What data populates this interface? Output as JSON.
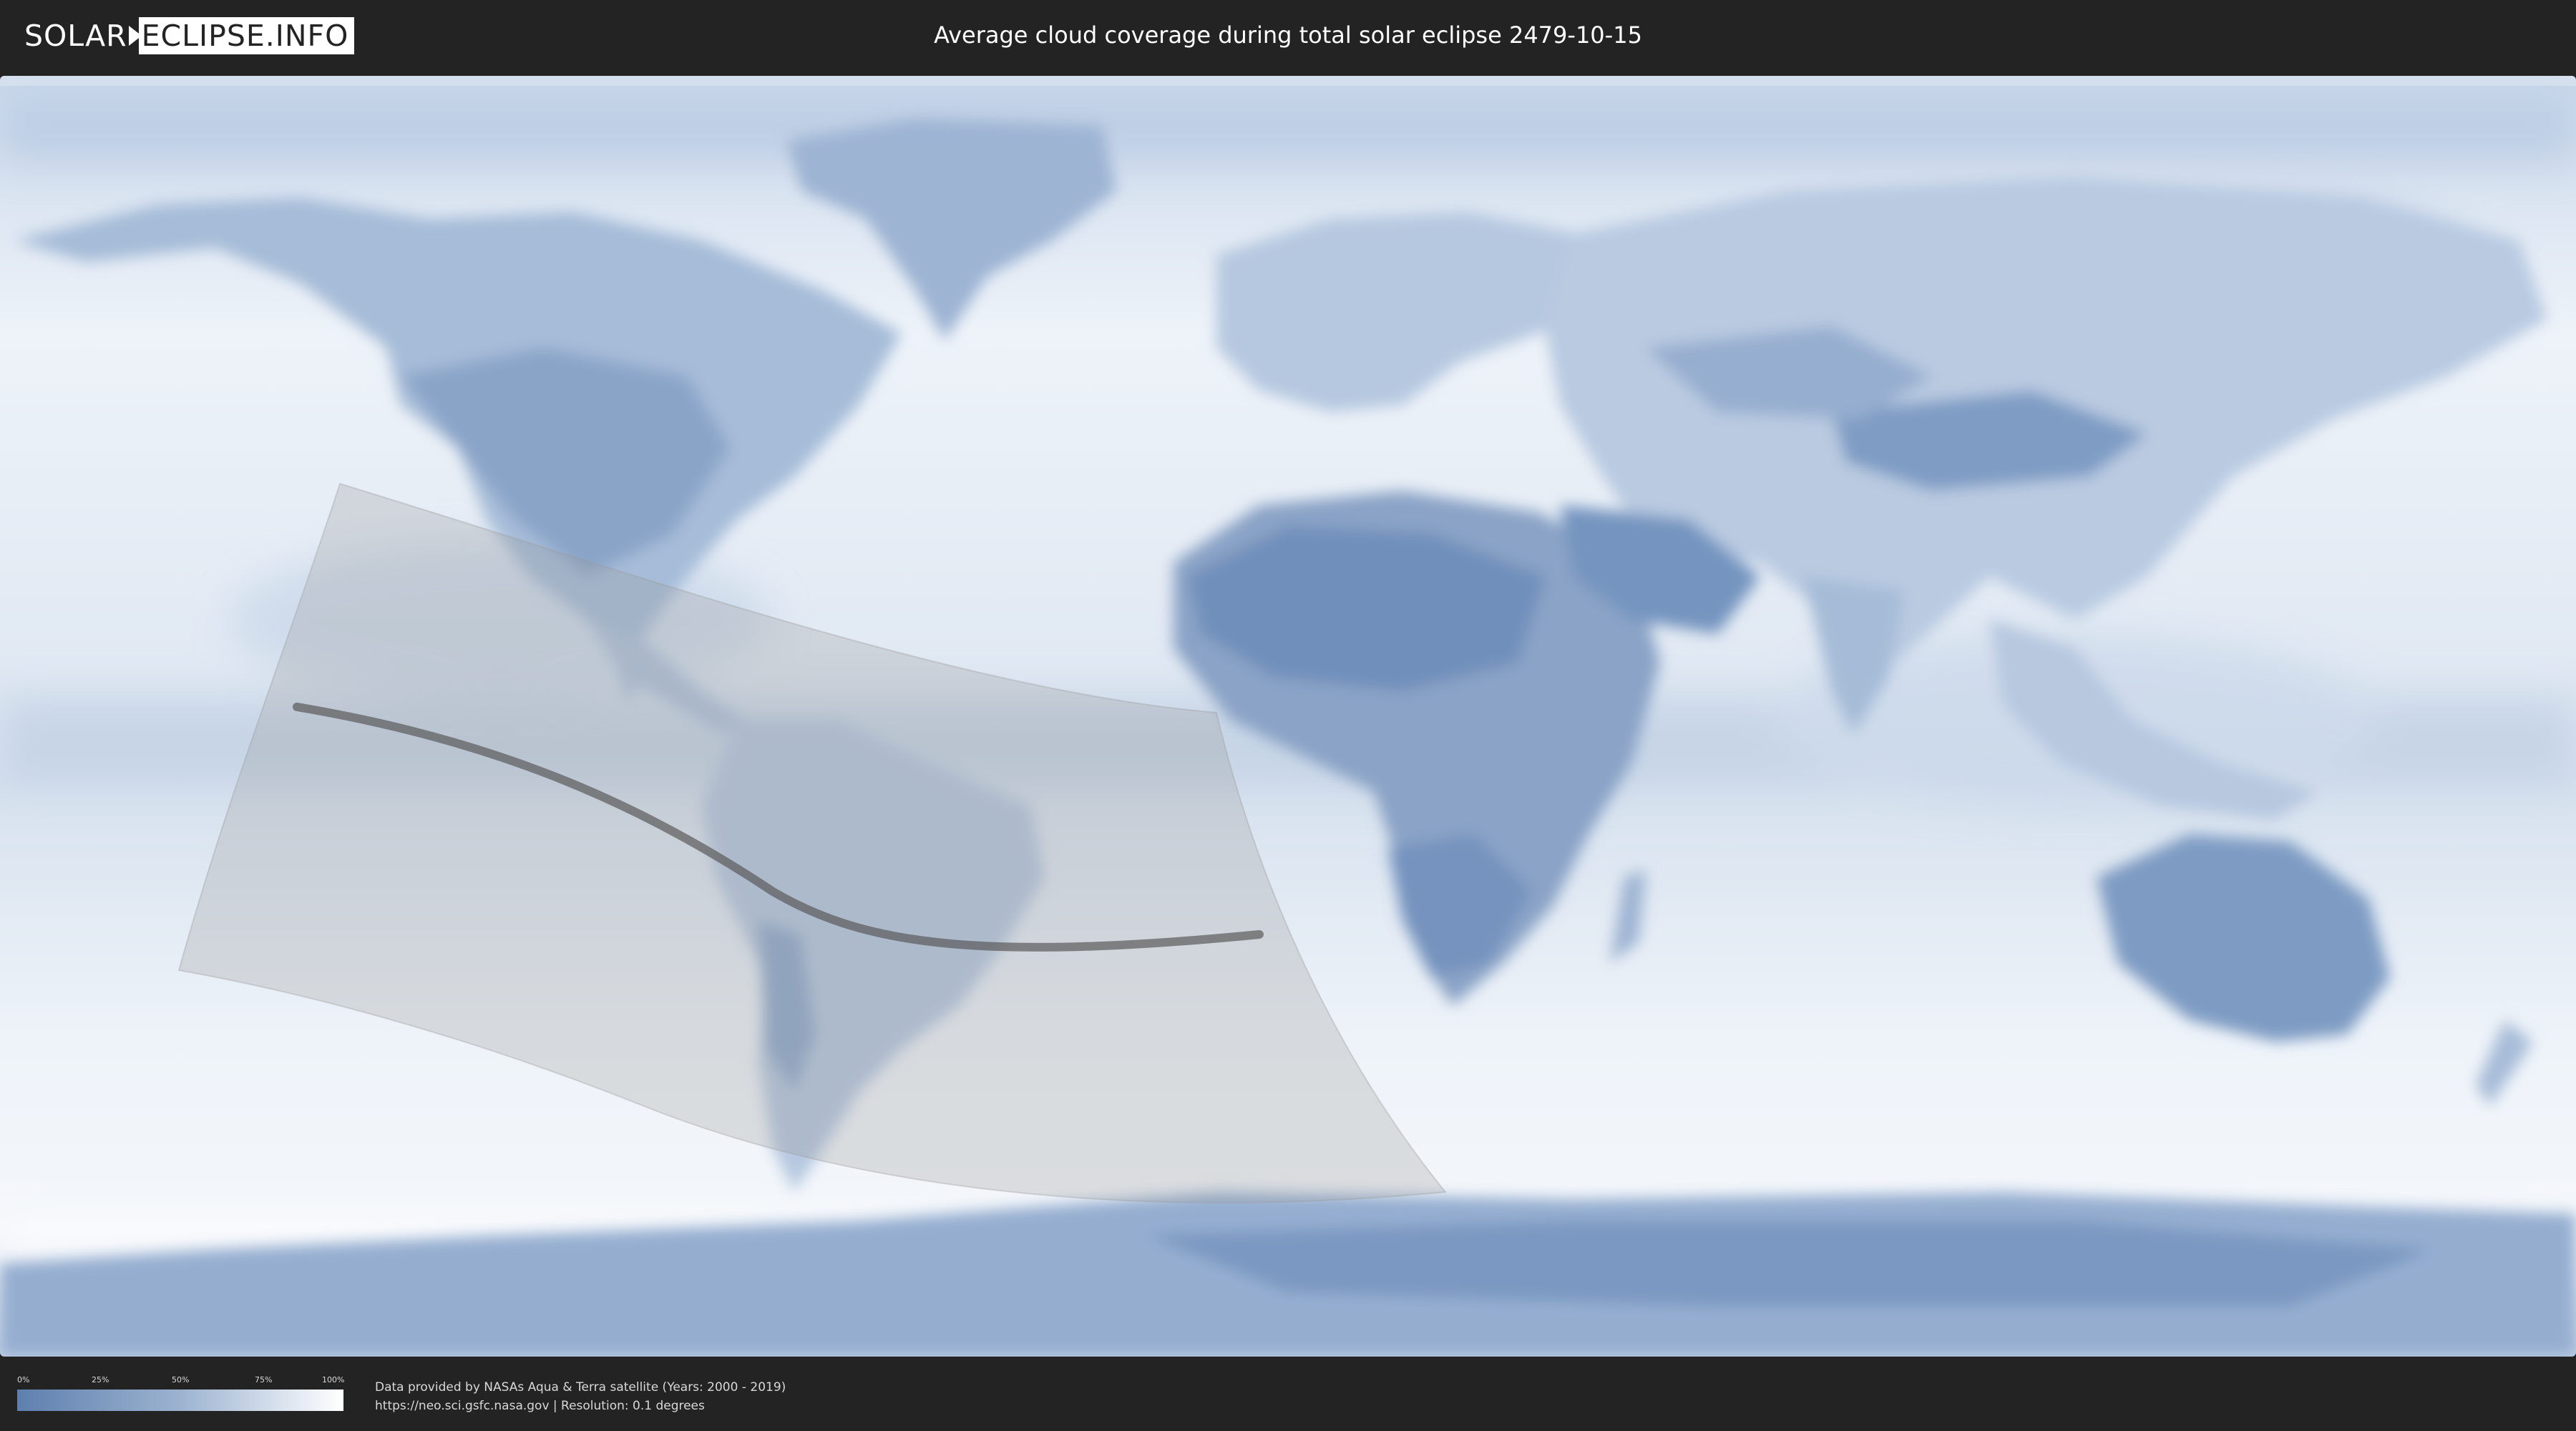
{
  "header": {
    "logo_left": "SOLAR",
    "logo_right": "ECLIPSE.INFO",
    "title": "Average cloud coverage during total solar eclipse 2479-10-15"
  },
  "colors": {
    "background": "#232323",
    "ocean_cloud": "#e8eef6",
    "land_clear": "#6f8fbb",
    "shadow": "#9a9a9a",
    "central_line": "#5a5a5a"
  },
  "legend": {
    "ticks": [
      "0%",
      "25%",
      "50%",
      "75%",
      "100%"
    ],
    "gradient_from": "#5e7fae",
    "gradient_to": "#ffffff"
  },
  "footer": {
    "credit_line1": "Data provided by NASAs Aqua & Terra satellite (Years: 2000 - 2019)",
    "credit_line2": "https://neo.sci.gsfc.nasa.gov | Resolution: 0.1 degrees"
  }
}
